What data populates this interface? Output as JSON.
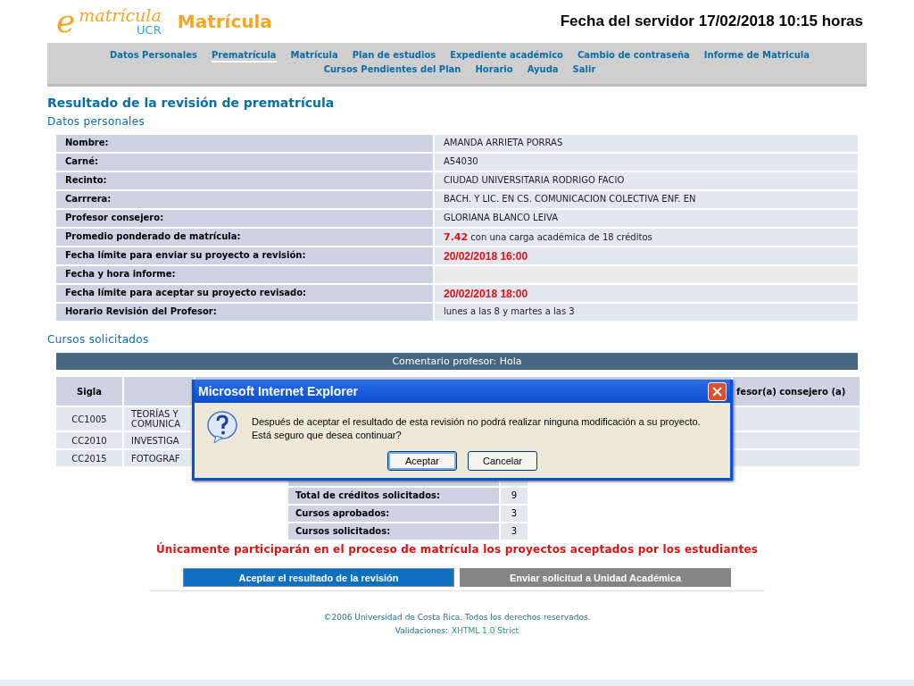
{
  "header": {
    "logo_letter": "e",
    "logo_text": "matrícula",
    "logo_sub": "UCR",
    "title": "Matrícula",
    "server_date": "Fecha del servidor 17/02/2018 10:15 horas"
  },
  "nav": {
    "items": [
      {
        "label": "Datos Personales",
        "selected": false
      },
      {
        "label": "Prematrícula",
        "selected": true
      },
      {
        "label": "Matrícula",
        "selected": false
      },
      {
        "label": "Plan de estudios",
        "selected": false
      },
      {
        "label": "Expediente académico",
        "selected": false
      },
      {
        "label": "Cambio de contraseña",
        "selected": false
      },
      {
        "label": "Informe de Matricula",
        "selected": false
      },
      {
        "label": "Cursos Pendientes del Plan",
        "selected": false
      },
      {
        "label": "Horario",
        "selected": false
      },
      {
        "label": "Ayuda",
        "selected": false
      },
      {
        "label": "Salir",
        "selected": false
      }
    ]
  },
  "heading": "Resultado de la revisión de prematrícula",
  "personal": {
    "title": "Datos personales",
    "rows": [
      {
        "label": "Nombre:",
        "value": "AMANDA ARRIETA PORRAS",
        "kind": "text"
      },
      {
        "label": "Carné:",
        "value": "A54030",
        "kind": "text"
      },
      {
        "label": "Recinto:",
        "value": "CIUDAD UNIVERSITARIA RODRIGO FACIO",
        "kind": "text"
      },
      {
        "label": "Carrrera:",
        "value": "BACH. Y LIC. EN CS. COMUNICACION COLECTIVA ENF. EN",
        "kind": "text"
      },
      {
        "label": "Profesor consejero:",
        "value": "GLORIANA BLANCO LEIVA",
        "kind": "text"
      },
      {
        "label": "Promedio ponderado de matrícula:",
        "value": "**7.42** con una carga académica de 18 créditos",
        "kind": "text"
      },
      {
        "label": "Fecha límite para enviar su proyecto a revisión:",
        "value": "20/02/2018 16:00",
        "kind": "deadline"
      },
      {
        "label": "Fecha y hora informe:",
        "kind": "empty"
      },
      {
        "label": "Fecha límite para aceptar su proyecto revisado:",
        "value": "20/02/2018 18:00",
        "kind": "deadline"
      },
      {
        "label": "Horario Revisión del Profesor:",
        "value": "lunes a las 8 y martes a las 3",
        "kind": "text"
      }
    ]
  },
  "courses": {
    "title": "Cursos solicitados",
    "comment": "Comentario profesor: Hola",
    "sigla_header": "Sigla",
    "advisor_header": "fesor(a) consejero (a)",
    "rows": [
      {
        "code": "CC1005",
        "name": "TEORÍAS Y COMUNICA"
      },
      {
        "code": "CC2010",
        "name": "INVESTIGA"
      },
      {
        "code": "CC2015",
        "name": "FOTOGRAF"
      }
    ]
  },
  "totals": [
    {
      "label": "Total de créditos solicitados:",
      "value": "9"
    },
    {
      "label": "Cursos aprobados:",
      "value": "3"
    },
    {
      "label": "Cursos solicitados:",
      "value": "3"
    }
  ],
  "notice": "Únicamente participarán en el proceso de matrícula los proyectos aceptados por los estudiantes",
  "actions": [
    {
      "label": "Aceptar el resultado de la revisión",
      "kind": "primary"
    },
    {
      "label": "Enviar solicitud a Unidad Académica",
      "kind": "secondary"
    }
  ],
  "footer": {
    "copyright": "©2006 Universidad de Costa Rica. Todos los derechos reservados.",
    "validations": "Validaciones:",
    "link": "XHTML 1.0 Strict"
  },
  "dialog": {
    "title": "Microsoft Internet Explorer",
    "lines": [
      "Después de aceptar el resultado de esta revisión no podrá realizar ninguna modificación a su proyecto.",
      "Está seguro que desea continuar?"
    ],
    "buttons": [
      {
        "label": "Aceptar",
        "selected": true
      },
      {
        "label": "Cancelar",
        "selected": false
      }
    ]
  }
}
